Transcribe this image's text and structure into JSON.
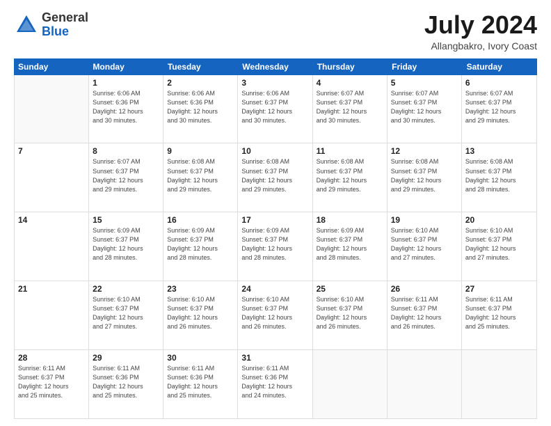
{
  "logo": {
    "general": "General",
    "blue": "Blue"
  },
  "title": "July 2024",
  "subtitle": "Allangbakro, Ivory Coast",
  "calendar": {
    "weekdays": [
      "Sunday",
      "Monday",
      "Tuesday",
      "Wednesday",
      "Thursday",
      "Friday",
      "Saturday"
    ],
    "weeks": [
      [
        {
          "day": "",
          "info": ""
        },
        {
          "day": "1",
          "info": "Sunrise: 6:06 AM\nSunset: 6:36 PM\nDaylight: 12 hours\nand 30 minutes."
        },
        {
          "day": "2",
          "info": "Sunrise: 6:06 AM\nSunset: 6:36 PM\nDaylight: 12 hours\nand 30 minutes."
        },
        {
          "day": "3",
          "info": "Sunrise: 6:06 AM\nSunset: 6:37 PM\nDaylight: 12 hours\nand 30 minutes."
        },
        {
          "day": "4",
          "info": "Sunrise: 6:07 AM\nSunset: 6:37 PM\nDaylight: 12 hours\nand 30 minutes."
        },
        {
          "day": "5",
          "info": "Sunrise: 6:07 AM\nSunset: 6:37 PM\nDaylight: 12 hours\nand 30 minutes."
        },
        {
          "day": "6",
          "info": "Sunrise: 6:07 AM\nSunset: 6:37 PM\nDaylight: 12 hours\nand 29 minutes."
        }
      ],
      [
        {
          "day": "7",
          "info": ""
        },
        {
          "day": "8",
          "info": "Sunrise: 6:07 AM\nSunset: 6:37 PM\nDaylight: 12 hours\nand 29 minutes."
        },
        {
          "day": "9",
          "info": "Sunrise: 6:08 AM\nSunset: 6:37 PM\nDaylight: 12 hours\nand 29 minutes."
        },
        {
          "day": "10",
          "info": "Sunrise: 6:08 AM\nSunset: 6:37 PM\nDaylight: 12 hours\nand 29 minutes."
        },
        {
          "day": "11",
          "info": "Sunrise: 6:08 AM\nSunset: 6:37 PM\nDaylight: 12 hours\nand 29 minutes."
        },
        {
          "day": "12",
          "info": "Sunrise: 6:08 AM\nSunset: 6:37 PM\nDaylight: 12 hours\nand 29 minutes."
        },
        {
          "day": "13",
          "info": "Sunrise: 6:08 AM\nSunset: 6:37 PM\nDaylight: 12 hours\nand 28 minutes."
        }
      ],
      [
        {
          "day": "14",
          "info": ""
        },
        {
          "day": "15",
          "info": "Sunrise: 6:09 AM\nSunset: 6:37 PM\nDaylight: 12 hours\nand 28 minutes."
        },
        {
          "day": "16",
          "info": "Sunrise: 6:09 AM\nSunset: 6:37 PM\nDaylight: 12 hours\nand 28 minutes."
        },
        {
          "day": "17",
          "info": "Sunrise: 6:09 AM\nSunset: 6:37 PM\nDaylight: 12 hours\nand 28 minutes."
        },
        {
          "day": "18",
          "info": "Sunrise: 6:09 AM\nSunset: 6:37 PM\nDaylight: 12 hours\nand 28 minutes."
        },
        {
          "day": "19",
          "info": "Sunrise: 6:10 AM\nSunset: 6:37 PM\nDaylight: 12 hours\nand 27 minutes."
        },
        {
          "day": "20",
          "info": "Sunrise: 6:10 AM\nSunset: 6:37 PM\nDaylight: 12 hours\nand 27 minutes."
        }
      ],
      [
        {
          "day": "21",
          "info": ""
        },
        {
          "day": "22",
          "info": "Sunrise: 6:10 AM\nSunset: 6:37 PM\nDaylight: 12 hours\nand 27 minutes."
        },
        {
          "day": "23",
          "info": "Sunrise: 6:10 AM\nSunset: 6:37 PM\nDaylight: 12 hours\nand 26 minutes."
        },
        {
          "day": "24",
          "info": "Sunrise: 6:10 AM\nSunset: 6:37 PM\nDaylight: 12 hours\nand 26 minutes."
        },
        {
          "day": "25",
          "info": "Sunrise: 6:10 AM\nSunset: 6:37 PM\nDaylight: 12 hours\nand 26 minutes."
        },
        {
          "day": "26",
          "info": "Sunrise: 6:11 AM\nSunset: 6:37 PM\nDaylight: 12 hours\nand 26 minutes."
        },
        {
          "day": "27",
          "info": "Sunrise: 6:11 AM\nSunset: 6:37 PM\nDaylight: 12 hours\nand 25 minutes."
        }
      ],
      [
        {
          "day": "28",
          "info": "Sunrise: 6:11 AM\nSunset: 6:37 PM\nDaylight: 12 hours\nand 25 minutes."
        },
        {
          "day": "29",
          "info": "Sunrise: 6:11 AM\nSunset: 6:36 PM\nDaylight: 12 hours\nand 25 minutes."
        },
        {
          "day": "30",
          "info": "Sunrise: 6:11 AM\nSunset: 6:36 PM\nDaylight: 12 hours\nand 25 minutes."
        },
        {
          "day": "31",
          "info": "Sunrise: 6:11 AM\nSunset: 6:36 PM\nDaylight: 12 hours\nand 24 minutes."
        },
        {
          "day": "",
          "info": ""
        },
        {
          "day": "",
          "info": ""
        },
        {
          "day": "",
          "info": ""
        }
      ]
    ]
  }
}
